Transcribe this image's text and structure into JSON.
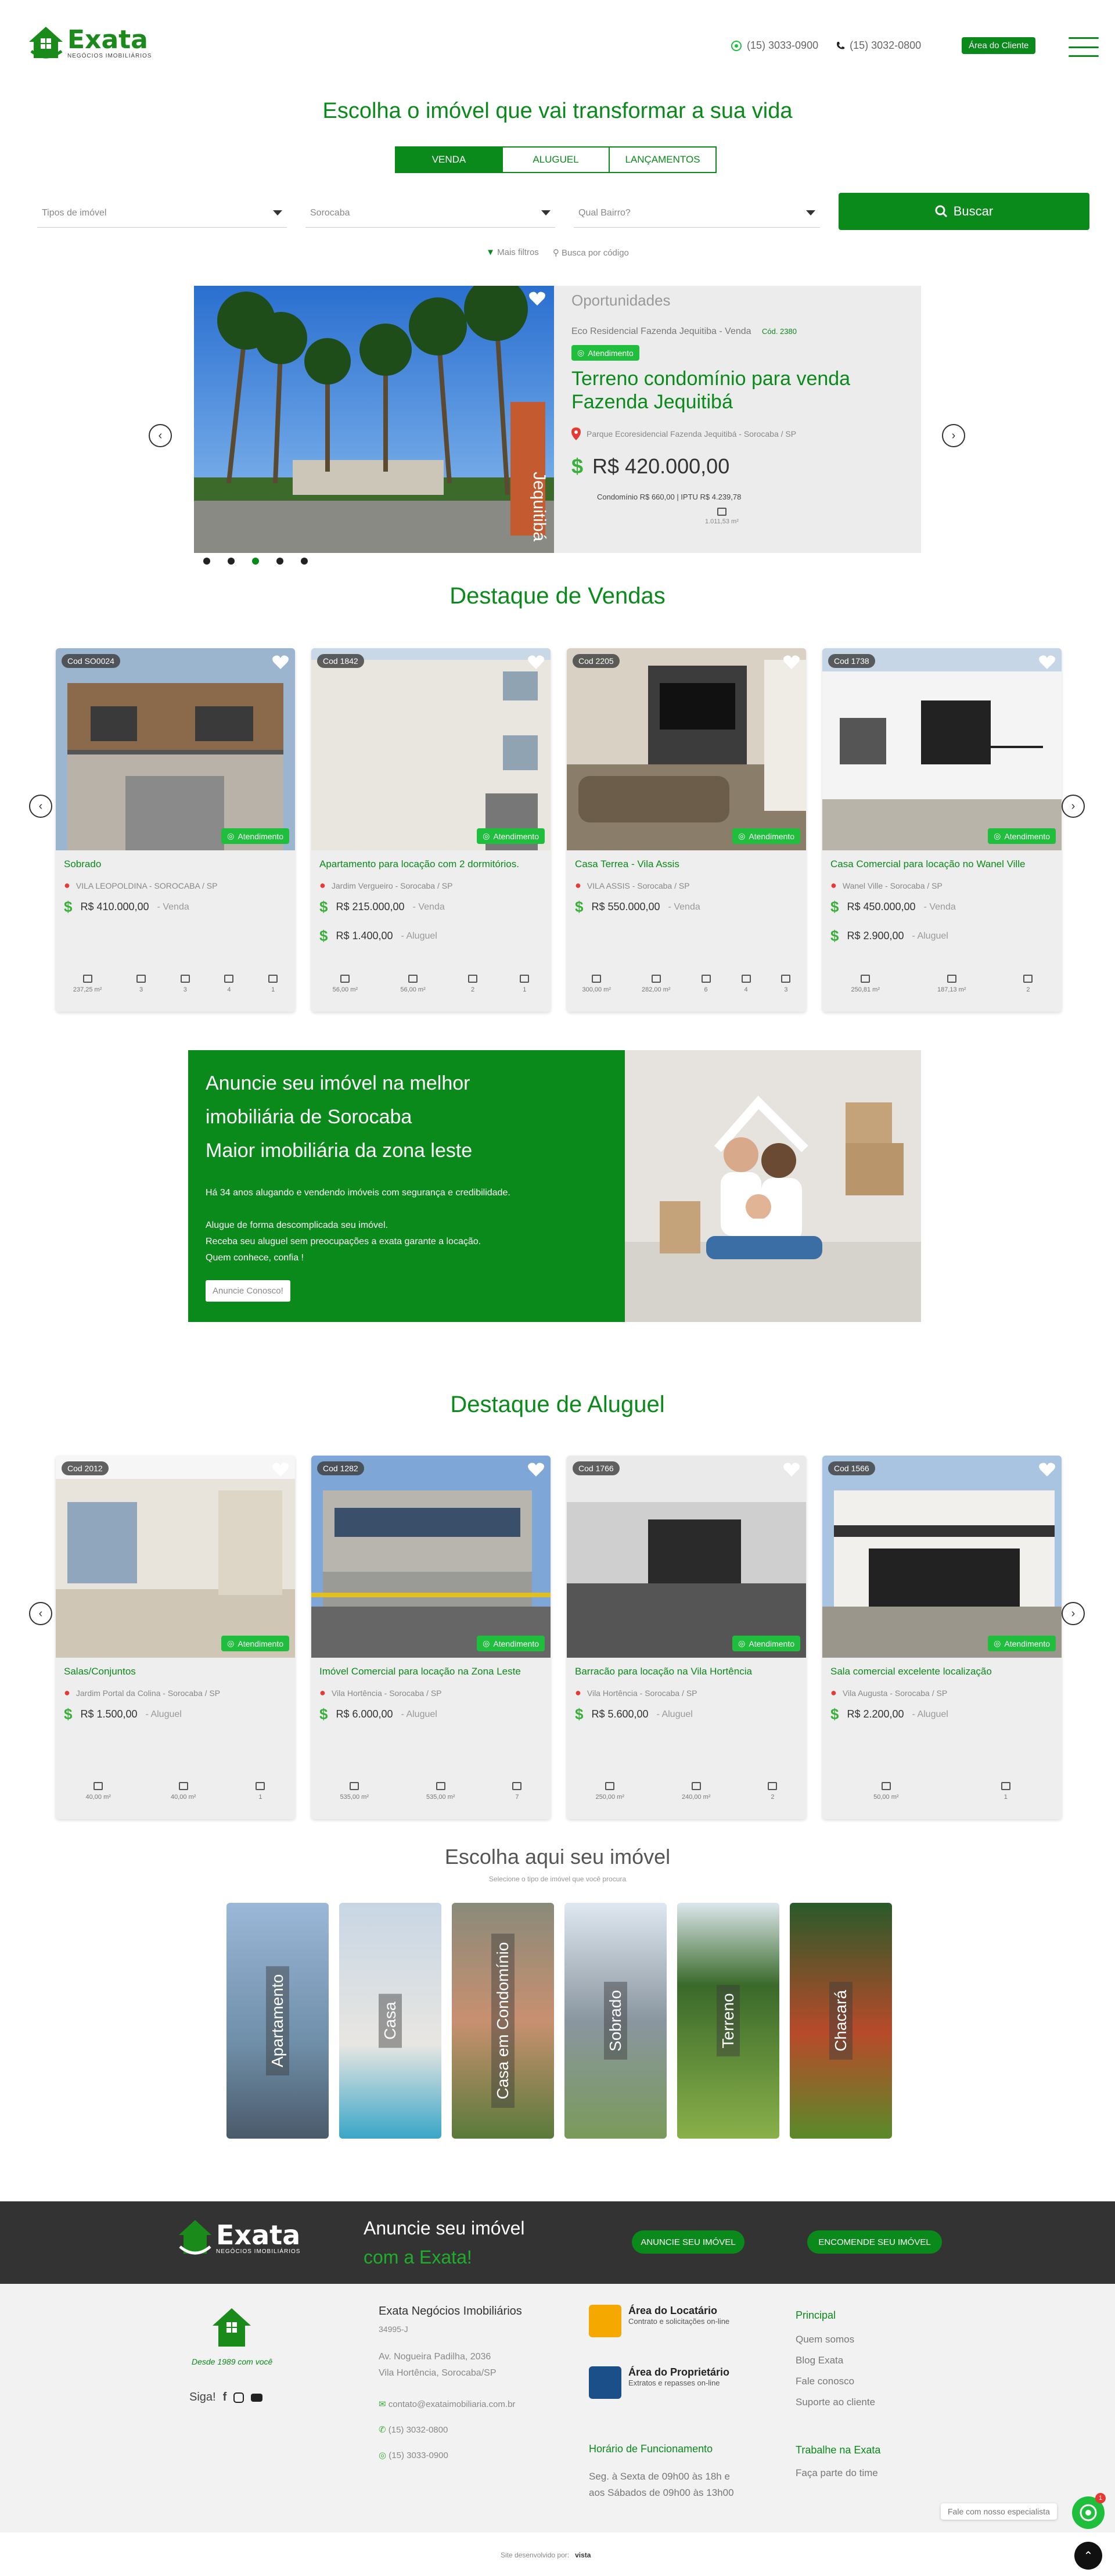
{
  "header": {
    "logo_text": "Exata",
    "logo_sub": "NEGÓCIOS IMOBILIÁRIOS",
    "phone_whatsapp": "(15) 3033-0900",
    "phone": "(15) 3032-0800",
    "client_area": "Área do Cliente"
  },
  "search": {
    "title": "Escolha o imóvel que vai transformar a sua vida",
    "tabs": [
      "VENDA",
      "ALUGUEL",
      "LANÇAMENTOS"
    ],
    "type_placeholder": "Tipos de imóvel",
    "city": "Sorocaba",
    "neighborhood_placeholder": "Qual Bairro?",
    "button": "Buscar",
    "more_filters": "Mais filtros",
    "code_search": "Busca por código"
  },
  "featured": {
    "section": "Oportunidades",
    "subtitle": "Eco Residencial Fazenda Jequitiba - Venda",
    "code": "Cód. 2380",
    "atendimento": "Atendimento",
    "title": "Terreno condomínio para venda Fazenda Jequitibá",
    "location": "Parque Ecoresidencial Fazenda Jequitibá - Sorocaba / SP",
    "price": "R$ 420.000,00",
    "fees": "Condomínio R$ 660,00 | IPTU R$ 4.239,78",
    "area": "1.011,53 m²",
    "sign_text": "Jequitibá"
  },
  "sales": {
    "title": "Destaque de Vendas",
    "cards": [
      {
        "code": "Cod SO0024",
        "title": "Sobrado",
        "location": "VILA LEOPOLDINA - SOROCABA / SP",
        "price": "R$ 410.000,00",
        "kind": "- Venda",
        "price2": "",
        "kind2": "",
        "feats": [
          "237,25 m²",
          "3",
          "3",
          "4",
          "1"
        ]
      },
      {
        "code": "Cod 1842",
        "title": "Apartamento para locação com 2 dormitórios.",
        "location": "Jardim Vergueiro - Sorocaba / SP",
        "price": "R$ 215.000,00",
        "kind": "- Venda",
        "price2": "R$ 1.400,00",
        "kind2": "- Aluguel",
        "feats": [
          "56,00 m²",
          "56,00 m²",
          "2",
          "1"
        ]
      },
      {
        "code": "Cod 2205",
        "title": "Casa Terrea - Vila Assis",
        "location": "VILA ASSIS - Sorocaba / SP",
        "price": "R$ 550.000,00",
        "kind": "- Venda",
        "price2": "",
        "kind2": "",
        "feats": [
          "300,00 m²",
          "282,00 m²",
          "6",
          "4",
          "3"
        ]
      },
      {
        "code": "Cod 1738",
        "title": "Casa Comercial para locação no Wanel Ville",
        "location": "Wanel Ville - Sorocaba / SP",
        "price": "R$ 450.000,00",
        "kind": "- Venda",
        "price2": "R$ 2.900,00",
        "kind2": "- Aluguel",
        "feats": [
          "250,81 m²",
          "187,13 m²",
          "2"
        ]
      }
    ]
  },
  "banner": {
    "line1": "Anuncie seu imóvel na melhor",
    "line2": "imobiliária de Sorocaba",
    "line3": "Maior imobiliária da zona leste",
    "p1": "Há 34 anos alugando e vendendo imóveis com segurança e credibilidade.",
    "p2": "Alugue de forma descomplicada seu imóvel.",
    "p3": "Receba seu aluguel sem preocupações a exata garante a locação.",
    "p4": "Quem conhece, confia !",
    "button": "Anuncie Conosco!"
  },
  "rent": {
    "title": "Destaque de Aluguel",
    "cards": [
      {
        "code": "Cod 2012",
        "title": "Salas/Conjuntos",
        "location": "Jardim Portal da Colina - Sorocaba / SP",
        "price": "R$ 1.500,00",
        "kind": "- Aluguel",
        "feats": [
          "40,00 m²",
          "40,00 m²",
          "1"
        ]
      },
      {
        "code": "Cod 1282",
        "title": "Imóvel Comercial para locação na Zona Leste",
        "location": "Vila Hortência - Sorocaba / SP",
        "price": "R$ 6.000,00",
        "kind": "- Aluguel",
        "feats": [
          "535,00 m²",
          "535,00 m²",
          "7"
        ]
      },
      {
        "code": "Cod 1766",
        "title": "Barracão para locação na Vila Hortência",
        "location": "Vila Hortência - Sorocaba / SP",
        "price": "R$ 5.600,00",
        "kind": "- Aluguel",
        "feats": [
          "250,00 m²",
          "240,00 m²",
          "2"
        ]
      },
      {
        "code": "Cod 1566",
        "title": "Sala comercial excelente localização",
        "location": "Vila Augusta - Sorocaba / SP",
        "price": "R$ 2.200,00",
        "kind": "- Aluguel",
        "feats": [
          "50,00 m²",
          "1"
        ]
      }
    ]
  },
  "categories": {
    "title": "Escolha aqui seu imóvel",
    "subtitle": "Selecione o tipo de imóvel que você procura",
    "items": [
      "Apartamento",
      "Casa",
      "Casa em Condomínio",
      "Sobrado",
      "Terreno",
      "Chacará"
    ]
  },
  "cta": {
    "line1": "Anuncie seu imóvel",
    "line2": "com a Exata!",
    "btn1": "ANUNCIE SEU IMÓVEL",
    "btn2": "ENCOMENDE SEU IMÓVEL"
  },
  "footer": {
    "since": "Desde 1989 com você",
    "follow": "Siga!",
    "company": "Exata Negócios Imobiliários",
    "creci": "34995-J",
    "address1": "Av. Nogueira Padilha, 2036",
    "address2": "Vila Hortência, Sorocaba/SP",
    "email": "contato@exataimobiliaria.com.br",
    "phone1": "(15) 3032-0800",
    "phone2": "(15) 3033-0900",
    "locatario_title": "Área do Locatário",
    "locatario_sub": "Contrato e solicitações on-line",
    "proprietario_title": "Área do Proprietário",
    "proprietario_sub": "Extratos e repasses on-line",
    "hours_title": "Horário de Funcionamento",
    "hours1": "Seg. à Sexta de 09h00 às 18h e",
    "hours2": "aos Sábados de 09h00 às 13h00",
    "principal_title": "Principal",
    "principal_links": [
      "Quem somos",
      "Blog Exata",
      "Fale conosco",
      "Suporte ao cliente"
    ],
    "work_title": "Trabalhe na Exata",
    "work_link": "Faça parte do time",
    "chat": "Fale com nosso especialista",
    "chat_badge": "1",
    "dev": "Site desenvolvido por:",
    "dev_brand": "vista"
  }
}
